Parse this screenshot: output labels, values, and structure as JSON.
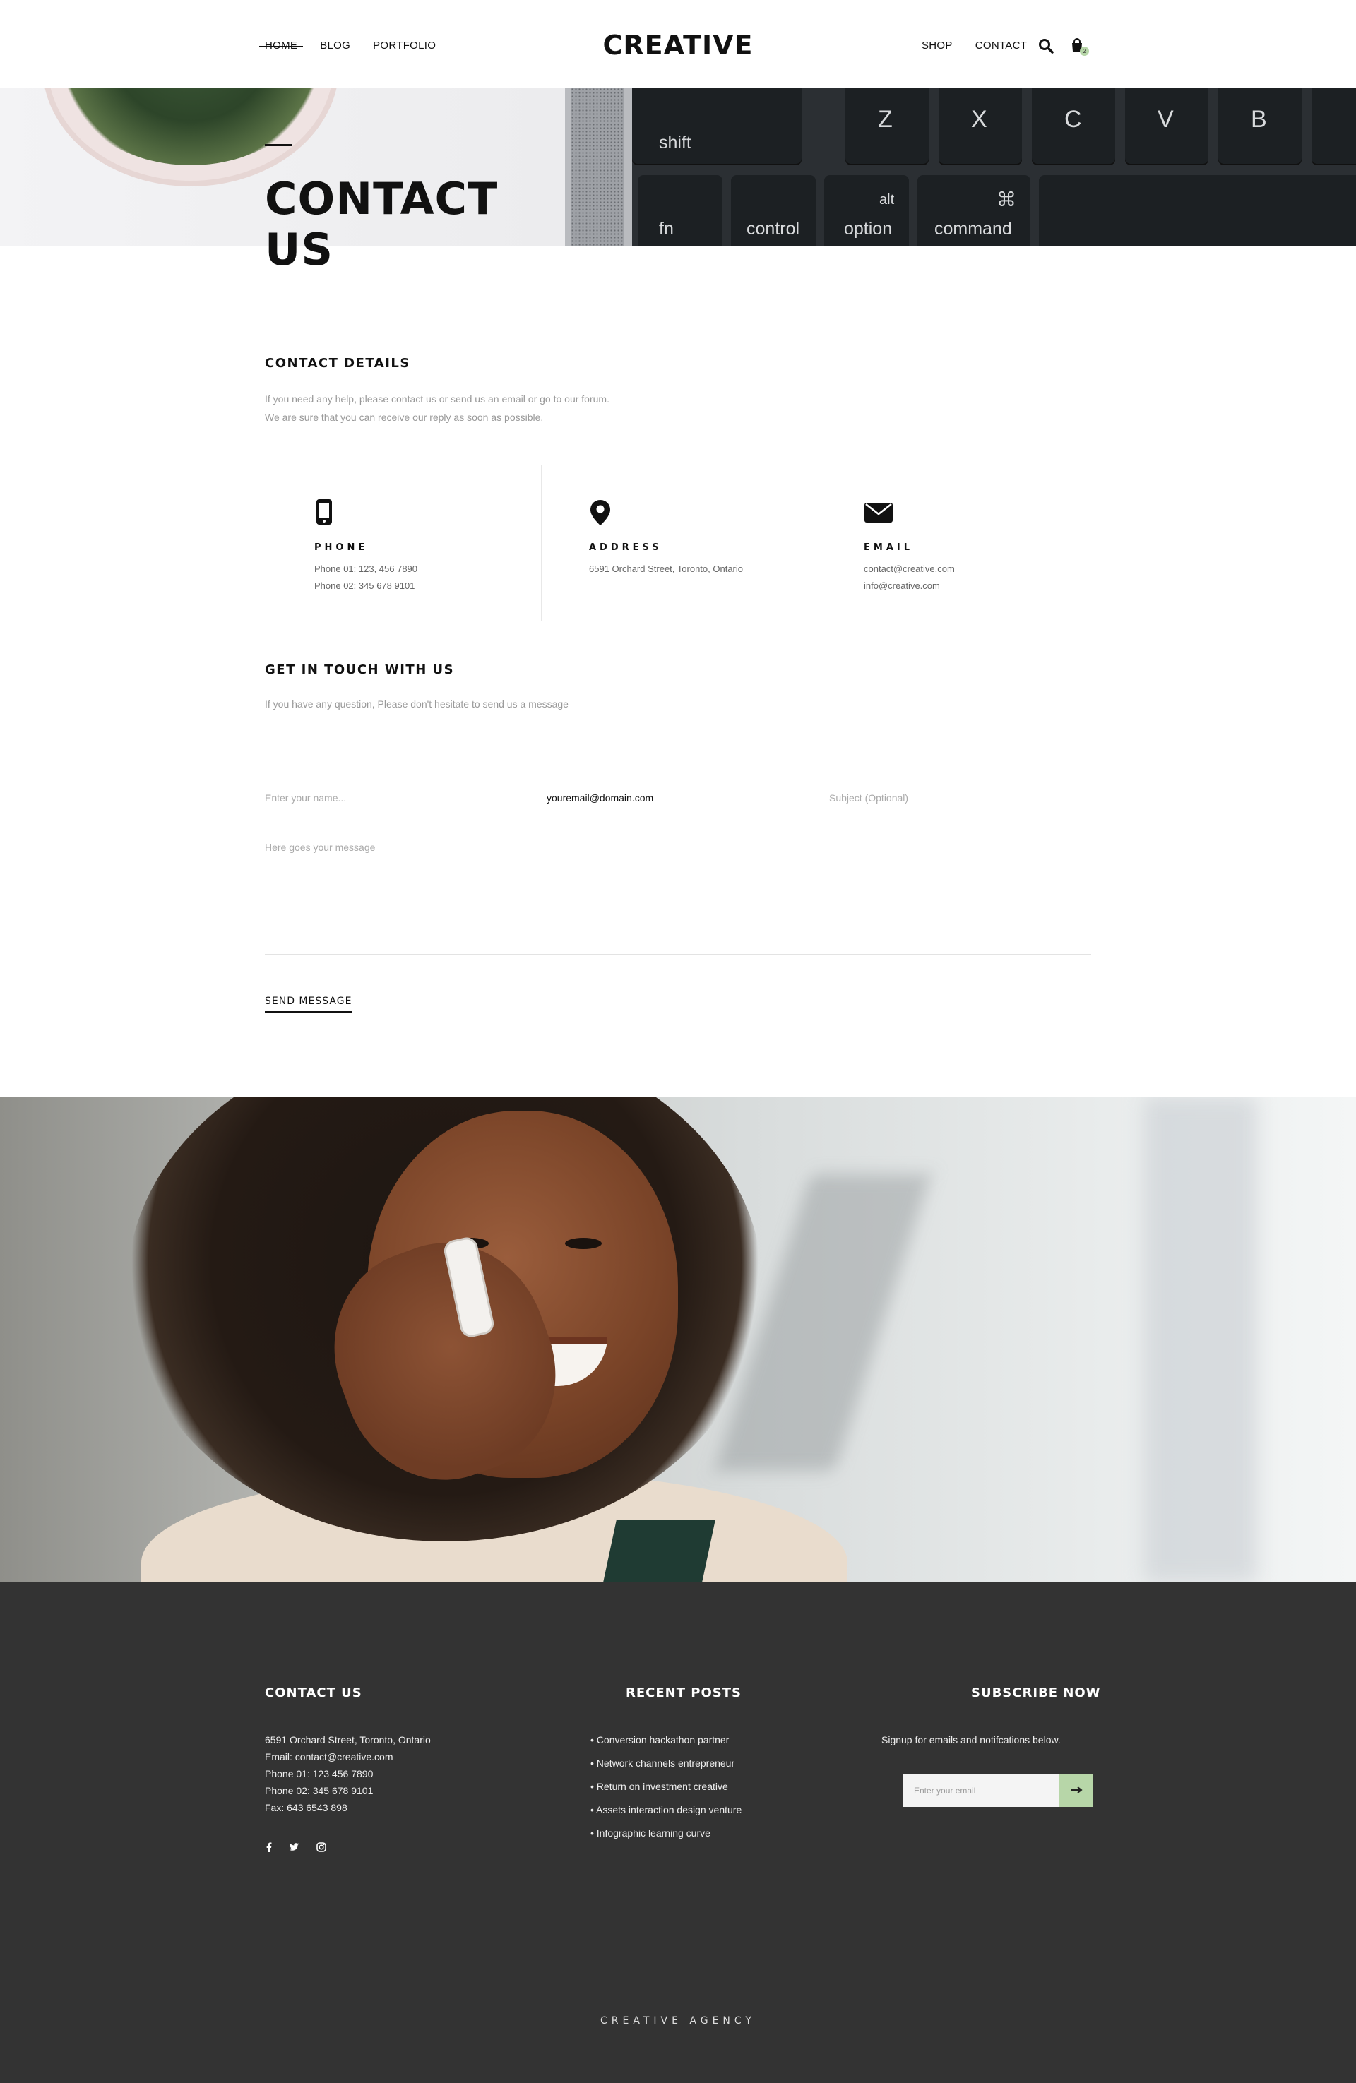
{
  "header": {
    "nav_left": [
      "HOME",
      "BLOG",
      "PORTFOLIO"
    ],
    "logo": "CREATIVE",
    "nav_right": [
      "SHOP",
      "CONTACT"
    ],
    "cart_count": "2",
    "colors": {
      "accent": "#b7d6a8",
      "text": "#111111"
    }
  },
  "hero": {
    "title_line1": "CONTACT",
    "title_line2": "US",
    "keys": {
      "shift": "shift",
      "z": "Z",
      "x": "X",
      "c": "C",
      "v": "V",
      "b": "B",
      "fn": "fn",
      "control": "control",
      "alt": "alt",
      "option": "option",
      "cmd_symbol": "⌘",
      "command": "command"
    }
  },
  "contact_details": {
    "title": "CONTACT DETAILS",
    "desc_line1": "If you need any help, please contact us or send us an email or go to our forum.",
    "desc_line2": "We are sure that you can receive our reply as soon as possible.",
    "cards": [
      {
        "icon": "phone-icon",
        "label": "PHONE",
        "lines": [
          "Phone 01: 123, 456 7890",
          "Phone 02: 345 678 9101"
        ]
      },
      {
        "icon": "map-pin-icon",
        "label": "ADDRESS",
        "lines": [
          "6591 Orchard Street, Toronto, Ontario"
        ]
      },
      {
        "icon": "envelope-icon",
        "label": "EMAIL",
        "lines": [
          "contact@creative.com",
          "info@creative.com"
        ]
      }
    ]
  },
  "form": {
    "title": "GET IN TOUCH WITH US",
    "desc": "If you have any question, Please don't hesitate to send us a message",
    "name_placeholder": "Enter your name...",
    "email_value": "youremail@domain.com",
    "subject_placeholder": "Subject (Optional)",
    "message_placeholder": "Here goes your message",
    "send_label": "SEND MESSAGE"
  },
  "footer": {
    "contact_title": "CONTACT US",
    "contact_lines": [
      "6591 Orchard Street, Toronto, Ontario",
      "Email: contact@creative.com",
      "Phone 01: 123 456 7890",
      "Phone 02: 345 678 9101",
      "Fax: 643 6543 898"
    ],
    "social_icons": [
      "facebook-icon",
      "twitter-icon",
      "instagram-icon"
    ],
    "posts_title": "RECENT POSTS",
    "posts": [
      "• Conversion hackathon partner",
      "• Network channels entrepreneur",
      "• Return on investment creative",
      "• Assets interaction design venture",
      "• Infographic learning curve"
    ],
    "subscribe_title": "SUBSCRIBE NOW",
    "subscribe_desc": "Signup for emails and notifcations below.",
    "subscribe_placeholder": "Enter your email",
    "copyright": "CREATIVE AGENCY",
    "colors": {
      "background": "#333333",
      "accent": "#b7d6a8"
    }
  }
}
